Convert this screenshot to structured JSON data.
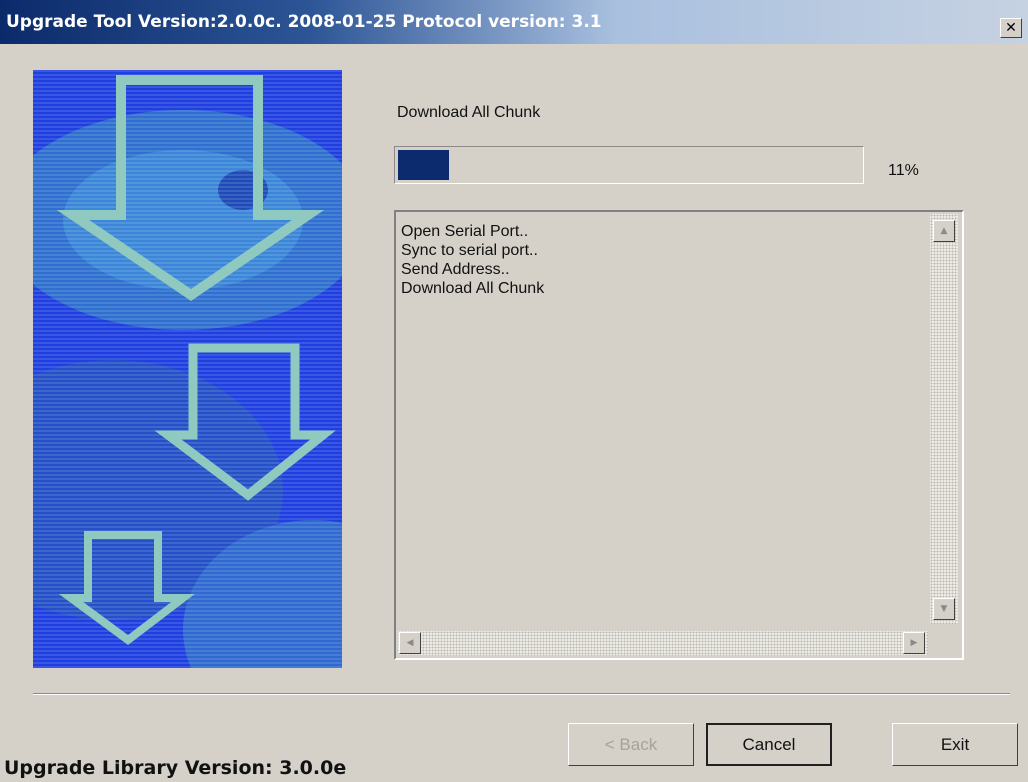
{
  "window": {
    "title": "Upgrade Tool Version:2.0.0c. 2008-01-25 Protocol version: 3.1",
    "close_glyph": "✕"
  },
  "progress": {
    "stage_label": "Download All Chunk",
    "percent_text": "11%",
    "fraction": 0.11
  },
  "log": {
    "lines": [
      "Open Serial Port..",
      "Sync to serial port..",
      "Send Address..",
      "Download All Chunk"
    ]
  },
  "buttons": {
    "back": "< Back",
    "cancel": "Cancel",
    "exit": "Exit"
  },
  "footer": {
    "library_version": "Upgrade Library Version: 3.0.0e"
  },
  "colors": {
    "progress_fill": "#0c2a6e",
    "banner_blue": "#1f3fe0"
  },
  "icons": {
    "scroll_up": "▲",
    "scroll_down": "▼",
    "scroll_left": "◀",
    "scroll_right": "▶"
  }
}
